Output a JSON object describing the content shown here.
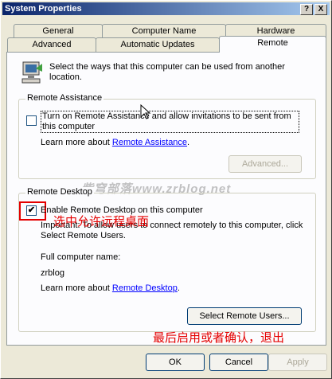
{
  "window": {
    "title": "System Properties",
    "help_btn": "?",
    "close_btn": "X"
  },
  "tabs_row1": [
    "General",
    "Computer Name",
    "Hardware"
  ],
  "tabs_row2": [
    "Advanced",
    "Automatic Updates",
    "Remote"
  ],
  "intro": "Select the ways that this computer can be used from another location.",
  "remote_assistance": {
    "legend": "Remote Assistance",
    "checkbox_label": "Turn on Remote Assistance and allow invitations to be sent from this computer",
    "checked": false,
    "learn_prefix": "Learn more about ",
    "learn_link": "Remote Assistance",
    "learn_suffix": ".",
    "advanced_btn": "Advanced..."
  },
  "remote_desktop": {
    "legend": "Remote Desktop",
    "checkbox_label": "Enable Remote Desktop on this computer",
    "checked": true,
    "important": "Important: To allow users to connect remotely to this computer, click Select Remote Users.",
    "fullname_label": "Full computer name:",
    "computer_name": "zrblog",
    "learn_prefix": "Learn more about ",
    "learn_link": "Remote Desktop",
    "learn_suffix": ".",
    "select_users_btn": "Select Remote Users..."
  },
  "annotations": {
    "check_note": "选中允许远程桌面",
    "bottom_note": "最后启用或者确认，退出",
    "watermark": "紫穹部落www.zrblog.net"
  },
  "footer": {
    "ok": "OK",
    "cancel": "Cancel",
    "apply": "Apply"
  },
  "colors": {
    "title_start": "#0a246a",
    "title_end": "#a6caf0",
    "annotation_red": "#e40000",
    "link": "#0000ff"
  }
}
